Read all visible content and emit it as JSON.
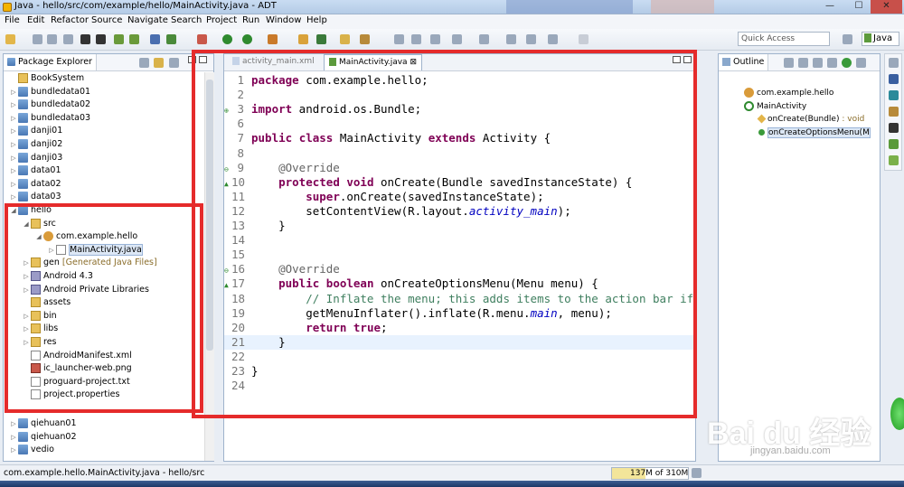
{
  "window": {
    "title": "Java - hello/src/com/example/hello/MainActivity.java - ADT",
    "controls": {
      "minimize": "—",
      "maximize": "☐",
      "close": "✕"
    }
  },
  "menu": [
    "File",
    "Edit",
    "Refactor",
    "Source",
    "Navigate",
    "Search",
    "Project",
    "Run",
    "Window",
    "Help"
  ],
  "toolbar": {
    "quick_access_placeholder": "Quick Access",
    "perspective": "Java"
  },
  "package_explorer": {
    "title": "Package Explorer",
    "items": [
      {
        "label": "BookSystem",
        "depth": 0,
        "icon": "folder-icon",
        "twisty": ""
      },
      {
        "label": "bundledata01",
        "depth": 0,
        "icon": "project-icon",
        "twisty": "▷"
      },
      {
        "label": "bundledata02",
        "depth": 0,
        "icon": "project-icon",
        "twisty": "▷"
      },
      {
        "label": "bundledata03",
        "depth": 0,
        "icon": "project-icon",
        "twisty": "▷"
      },
      {
        "label": "danji01",
        "depth": 0,
        "icon": "project-icon",
        "twisty": "▷"
      },
      {
        "label": "danji02",
        "depth": 0,
        "icon": "project-icon",
        "twisty": "▷"
      },
      {
        "label": "danji03",
        "depth": 0,
        "icon": "project-icon",
        "twisty": "▷"
      },
      {
        "label": "data01",
        "depth": 0,
        "icon": "project-icon",
        "twisty": "▷"
      },
      {
        "label": "data02",
        "depth": 0,
        "icon": "project-icon",
        "twisty": "▷"
      },
      {
        "label": "data03",
        "depth": 0,
        "icon": "project-icon",
        "twisty": "▷"
      },
      {
        "label": "hello",
        "depth": 0,
        "icon": "project-icon",
        "twisty": "◢"
      },
      {
        "label": "src",
        "depth": 1,
        "icon": "source-folder-icon",
        "twisty": "◢"
      },
      {
        "label": "com.example.hello",
        "depth": 2,
        "icon": "package-icon",
        "twisty": "◢"
      },
      {
        "label": "MainActivity.java",
        "depth": 3,
        "icon": "java-file-icon",
        "twisty": "▷",
        "selected": true
      },
      {
        "label": "gen",
        "depth": 1,
        "icon": "source-folder-icon",
        "twisty": "▷",
        "suffix": "[Generated Java Files]"
      },
      {
        "label": "Android 4.3",
        "depth": 1,
        "icon": "library-icon",
        "twisty": "▷"
      },
      {
        "label": "Android Private Libraries",
        "depth": 1,
        "icon": "library-icon",
        "twisty": "▷"
      },
      {
        "label": "assets",
        "depth": 1,
        "icon": "folder-icon",
        "twisty": ""
      },
      {
        "label": "bin",
        "depth": 1,
        "icon": "folder-icon",
        "twisty": "▷"
      },
      {
        "label": "libs",
        "depth": 1,
        "icon": "folder-icon",
        "twisty": "▷"
      },
      {
        "label": "res",
        "depth": 1,
        "icon": "folder-icon",
        "twisty": "▷"
      },
      {
        "label": "AndroidManifest.xml",
        "depth": 1,
        "icon": "xml-file-icon",
        "twisty": ""
      },
      {
        "label": "ic_launcher-web.png",
        "depth": 1,
        "icon": "image-file-icon",
        "twisty": ""
      },
      {
        "label": "proguard-project.txt",
        "depth": 1,
        "icon": "text-file-icon",
        "twisty": ""
      },
      {
        "label": "project.properties",
        "depth": 1,
        "icon": "properties-file-icon",
        "twisty": ""
      },
      {
        "label": "qiehuan01",
        "depth": 0,
        "icon": "project-icon",
        "twisty": "▷"
      },
      {
        "label": "qiehuan02",
        "depth": 0,
        "icon": "project-icon",
        "twisty": "▷"
      },
      {
        "label": "vedio",
        "depth": 0,
        "icon": "project-icon",
        "twisty": "▷"
      }
    ]
  },
  "editor": {
    "tabs": [
      {
        "label": "activity_main.xml",
        "active": false
      },
      {
        "label": "MainActivity.java",
        "active": true
      }
    ],
    "lines": [
      {
        "n": "1",
        "marker": "",
        "code": [
          {
            "t": "package",
            "c": "kw"
          },
          {
            "t": " com.example.hello;",
            "c": ""
          }
        ]
      },
      {
        "n": "2",
        "marker": "",
        "code": []
      },
      {
        "n": "3",
        "marker": "⊕",
        "code": [
          {
            "t": "import",
            "c": "kw"
          },
          {
            "t": " android.os.Bundle;",
            "c": ""
          }
        ]
      },
      {
        "n": "6",
        "marker": "",
        "code": []
      },
      {
        "n": "7",
        "marker": "",
        "code": [
          {
            "t": "public",
            "c": "kw"
          },
          {
            "t": " ",
            "c": ""
          },
          {
            "t": "class",
            "c": "kw"
          },
          {
            "t": " MainActivity ",
            "c": ""
          },
          {
            "t": "extends",
            "c": "kw"
          },
          {
            "t": " Activity {",
            "c": ""
          }
        ]
      },
      {
        "n": "8",
        "marker": "",
        "code": []
      },
      {
        "n": "9",
        "marker": "⊖",
        "code": [
          {
            "t": "    @Override",
            "c": "an"
          }
        ]
      },
      {
        "n": "10",
        "marker": "▲",
        "code": [
          {
            "t": "    ",
            "c": ""
          },
          {
            "t": "protected",
            "c": "kw"
          },
          {
            "t": " ",
            "c": ""
          },
          {
            "t": "void",
            "c": "kw"
          },
          {
            "t": " onCreate(Bundle savedInstanceState) {",
            "c": ""
          }
        ]
      },
      {
        "n": "11",
        "marker": "",
        "code": [
          {
            "t": "        ",
            "c": ""
          },
          {
            "t": "super",
            "c": "kw"
          },
          {
            "t": ".onCreate(savedInstanceState);",
            "c": ""
          }
        ]
      },
      {
        "n": "12",
        "marker": "",
        "code": [
          {
            "t": "        setContentView(R.layout.",
            "c": ""
          },
          {
            "t": "activity_main",
            "c": "fd"
          },
          {
            "t": ");",
            "c": ""
          }
        ]
      },
      {
        "n": "13",
        "marker": "",
        "code": [
          {
            "t": "    }",
            "c": ""
          }
        ]
      },
      {
        "n": "14",
        "marker": "",
        "code": []
      },
      {
        "n": "15",
        "marker": "",
        "code": []
      },
      {
        "n": "16",
        "marker": "⊖",
        "code": [
          {
            "t": "    @Override",
            "c": "an"
          }
        ]
      },
      {
        "n": "17",
        "marker": "▲",
        "code": [
          {
            "t": "    ",
            "c": ""
          },
          {
            "t": "public",
            "c": "kw"
          },
          {
            "t": " ",
            "c": ""
          },
          {
            "t": "boolean",
            "c": "kw"
          },
          {
            "t": " onCreateOptionsMenu(Menu menu) {",
            "c": ""
          }
        ]
      },
      {
        "n": "18",
        "marker": "",
        "code": [
          {
            "t": "        // Inflate the menu; this adds items to the action bar if",
            "c": "cm"
          }
        ]
      },
      {
        "n": "19",
        "marker": "",
        "code": [
          {
            "t": "        getMenuInflater().inflate(R.menu.",
            "c": ""
          },
          {
            "t": "main",
            "c": "fd"
          },
          {
            "t": ", menu);",
            "c": ""
          }
        ]
      },
      {
        "n": "20",
        "marker": "",
        "code": [
          {
            "t": "        ",
            "c": ""
          },
          {
            "t": "return",
            "c": "kw"
          },
          {
            "t": " ",
            "c": ""
          },
          {
            "t": "true",
            "c": "kw"
          },
          {
            "t": ";",
            "c": ""
          }
        ]
      },
      {
        "n": "21",
        "marker": "",
        "code": [
          {
            "t": "    }",
            "c": ""
          }
        ],
        "current": true
      },
      {
        "n": "22",
        "marker": "",
        "code": []
      },
      {
        "n": "23",
        "marker": "",
        "code": [
          {
            "t": "}",
            "c": ""
          }
        ]
      },
      {
        "n": "24",
        "marker": "",
        "code": []
      }
    ]
  },
  "outline": {
    "title": "Outline",
    "items": [
      {
        "label": "com.example.hello",
        "type": "",
        "depth": 0,
        "icon": "package-icon"
      },
      {
        "label": "MainActivity",
        "type": "",
        "depth": 0,
        "icon": "class-icon"
      },
      {
        "label": "onCreate(Bundle)",
        "type": " : void",
        "depth": 1,
        "icon": "protected-method-icon"
      },
      {
        "label": "onCreateOptionsMenu(M",
        "type": "",
        "depth": 1,
        "icon": "public-method-icon",
        "selected": true
      }
    ]
  },
  "status": {
    "selection": "com.example.hello.MainActivity.java - hello/src",
    "memory_text": "137M of 310M",
    "memory_used_fraction": 0.44
  },
  "watermark": {
    "brand": "Bai du 经验",
    "url": "jingyan.baidu.com"
  },
  "colors": {
    "highlight_box": "#e52b2b",
    "keyword": "#7f0055",
    "comment": "#3f7f5f",
    "field": "#0000c0",
    "annotation": "#646464"
  }
}
